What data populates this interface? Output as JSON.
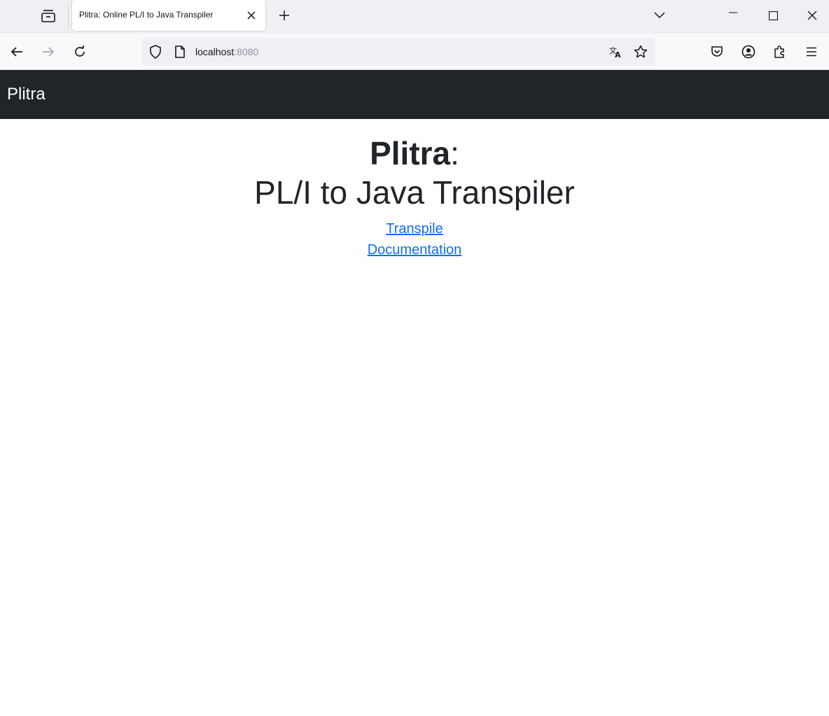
{
  "browser": {
    "tab": {
      "title": "Plitra: Online PL/I to Java Transpiler",
      "close_icon": "close-icon"
    },
    "url": {
      "host": "localhost",
      "port": ":8080"
    },
    "icons": {
      "tab_list": "tab-list-icon",
      "new_tab": "plus-icon",
      "list_all_tabs": "chevron-down-icon",
      "minimize": "minimize-icon",
      "maximize": "maximize-icon",
      "close_window": "close-icon",
      "back": "back-arrow-icon",
      "forward": "forward-arrow-icon",
      "reload": "reload-icon",
      "shield": "shield-icon",
      "page": "page-icon",
      "translate": "translate-icon",
      "bookmark": "star-icon",
      "pocket": "pocket-icon",
      "account": "account-icon",
      "extensions": "puzzle-icon",
      "menu": "hamburger-menu-icon"
    }
  },
  "site": {
    "brand": "Plitra",
    "hero": {
      "name": "Plitra",
      "colon": ":",
      "subtitle": "PL/I to Java Transpiler"
    },
    "links": [
      {
        "label": "Transpile"
      },
      {
        "label": "Documentation"
      }
    ]
  },
  "colors": {
    "navbar_bg": "#212529",
    "link": "#0d6efd",
    "text": "#212529"
  }
}
